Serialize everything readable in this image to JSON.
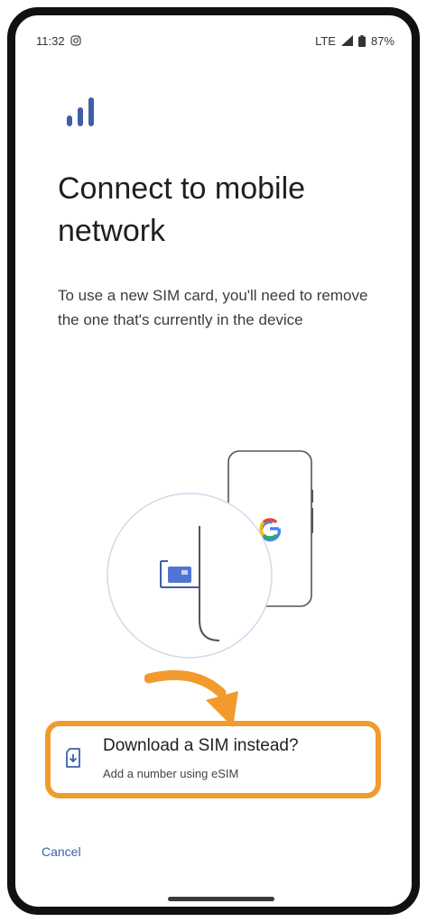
{
  "status_bar": {
    "time": "11:32",
    "network": "LTE",
    "battery": "87%",
    "icons": [
      "instagram-icon",
      "signal-icon",
      "battery-icon"
    ]
  },
  "header": {
    "icon": "signal-bars-icon",
    "title": "Connect to mobile network"
  },
  "body": {
    "description": "To use a new SIM card, you'll need to remove the one that's currently in the device"
  },
  "options": {
    "download_sim": {
      "icon": "sim-download-icon",
      "title": "Download a SIM instead?",
      "subtitle": "Add a number using eSIM"
    }
  },
  "footer": {
    "cancel_label": "Cancel"
  },
  "colors": {
    "accent": "#3d5fa8",
    "highlight": "#f29a2e"
  }
}
